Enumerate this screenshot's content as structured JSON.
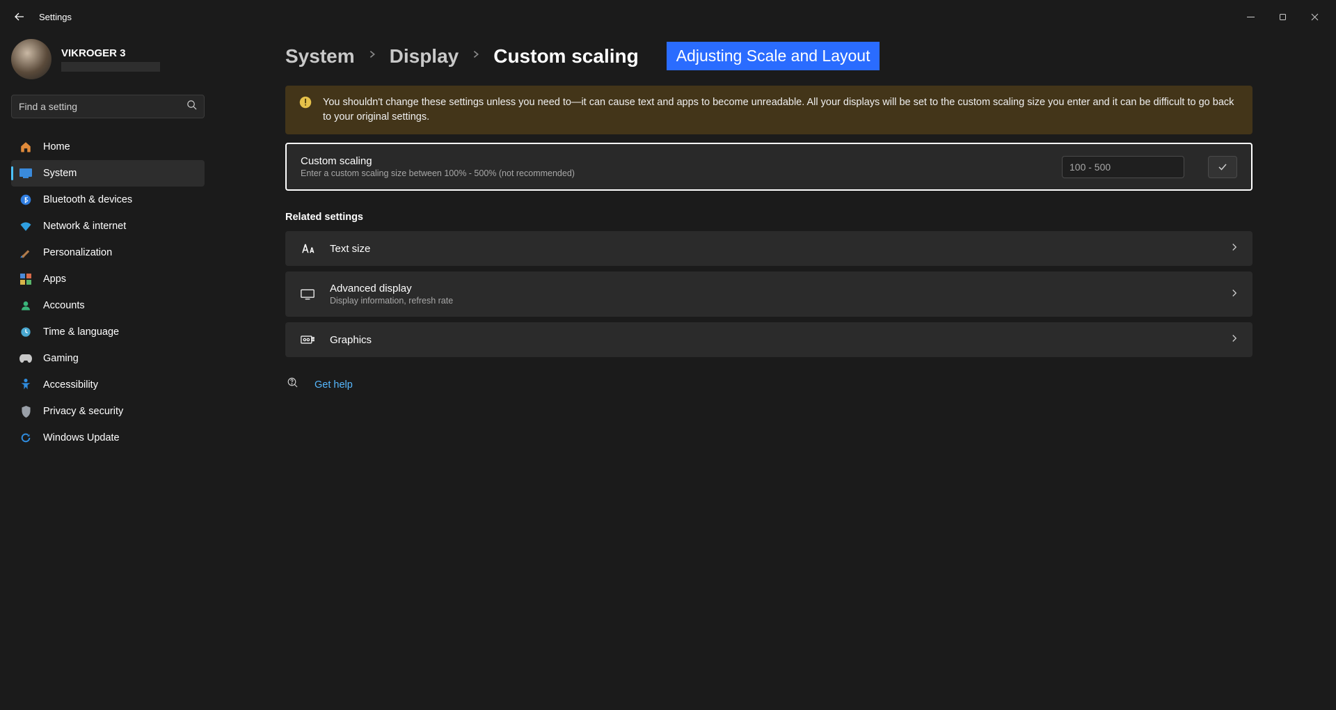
{
  "titlebar": {
    "title": "Settings"
  },
  "profile": {
    "name": "VIKROGER 3"
  },
  "search": {
    "placeholder": "Find a setting"
  },
  "nav": {
    "items": [
      {
        "label": "Home"
      },
      {
        "label": "System"
      },
      {
        "label": "Bluetooth & devices"
      },
      {
        "label": "Network & internet"
      },
      {
        "label": "Personalization"
      },
      {
        "label": "Apps"
      },
      {
        "label": "Accounts"
      },
      {
        "label": "Time & language"
      },
      {
        "label": "Gaming"
      },
      {
        "label": "Accessibility"
      },
      {
        "label": "Privacy & security"
      },
      {
        "label": "Windows Update"
      }
    ]
  },
  "breadcrumb": {
    "a": "System",
    "b": "Display",
    "c": "Custom scaling"
  },
  "annotation": "Adjusting Scale and Layout",
  "warning": "You shouldn't change these settings unless you need to—it can cause text and apps to become unreadable. All your displays will be set to the custom scaling size you enter and it can be difficult to go back to your original settings.",
  "customScaling": {
    "title": "Custom scaling",
    "sub": "Enter a custom scaling size between 100% - 500% (not recommended)",
    "placeholder": "100 - 500"
  },
  "related": {
    "heading": "Related settings",
    "textSize": {
      "title": "Text size"
    },
    "advancedDisplay": {
      "title": "Advanced display",
      "sub": "Display information, refresh rate"
    },
    "graphics": {
      "title": "Graphics"
    }
  },
  "help": {
    "label": "Get help"
  }
}
